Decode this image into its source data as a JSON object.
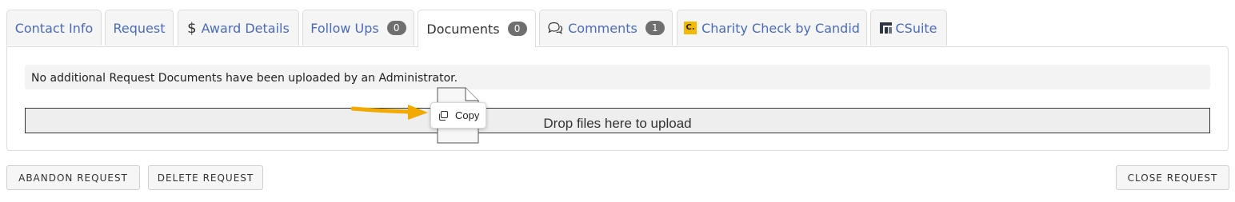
{
  "tabs": {
    "contact_info": "Contact Info",
    "request": "Request",
    "award_details": "Award Details",
    "award_icon": "$",
    "follow_ups": "Follow Ups",
    "follow_ups_count": "0",
    "documents": "Documents",
    "documents_count": "0",
    "comments": "Comments",
    "comments_count": "1",
    "charity_check": "Charity Check by Candid",
    "charity_logo_letter": "C.",
    "csuite": "CSuite",
    "active": "Documents"
  },
  "documents_panel": {
    "notice": "No additional Request Documents have been uploaded by an Administrator.",
    "dropzone_label": "Drop files here to upload",
    "drag_tooltip_label": "Copy"
  },
  "footer": {
    "abandon_label": "ABANDON REQUEST",
    "delete_label": "DELETE REQUEST",
    "close_label": "CLOSE REQUEST"
  },
  "colors": {
    "tab_link": "#4a6bbd",
    "badge": "#6f6f6f",
    "candid_logo": "#f5b800",
    "arrow": "#f2a900"
  },
  "icons": [
    "dollar-icon",
    "comments-icon",
    "candid-logo-icon",
    "csuite-logo-icon",
    "copy-icon",
    "file-icon",
    "arrow-icon"
  ]
}
